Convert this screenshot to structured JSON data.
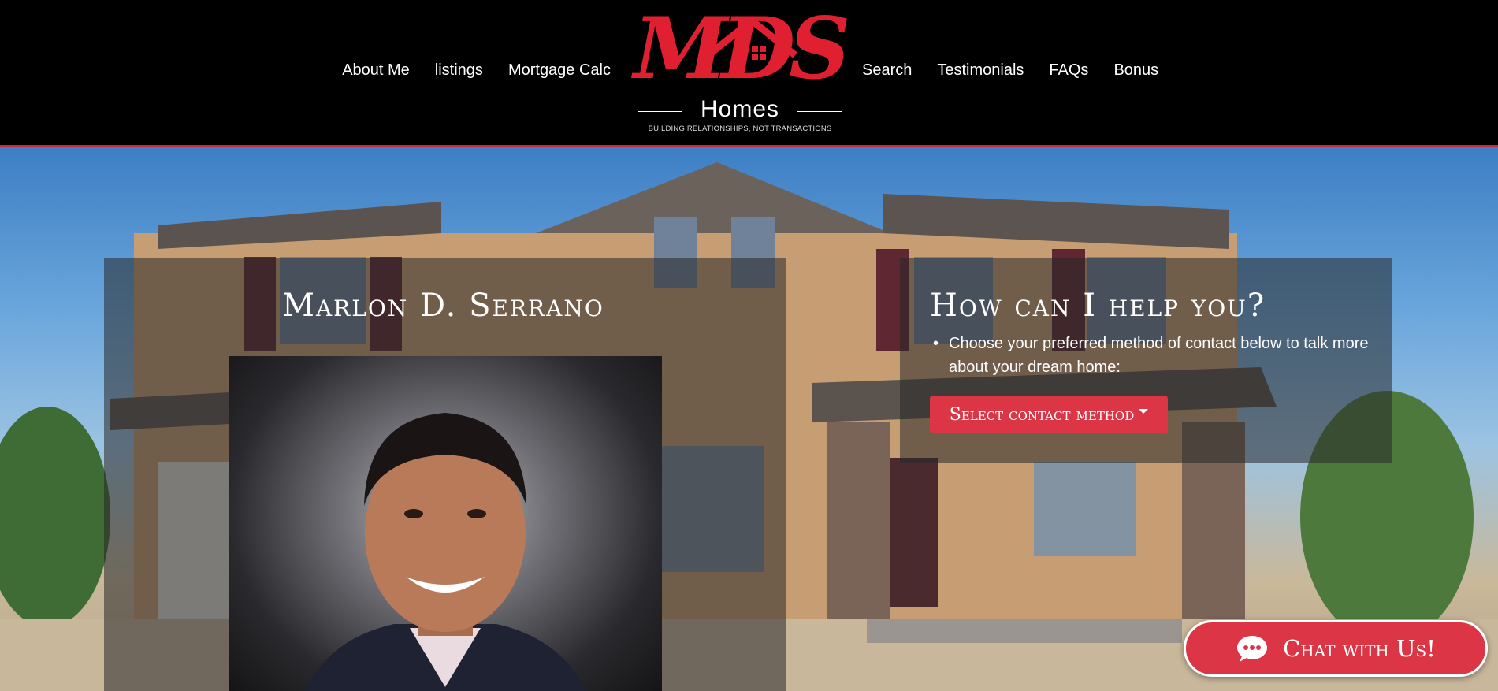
{
  "nav": {
    "left": [
      {
        "label": "About Me"
      },
      {
        "label": "listings"
      },
      {
        "label": "Mortgage Calc"
      }
    ],
    "right": [
      {
        "label": "Search"
      },
      {
        "label": "Testimonials"
      },
      {
        "label": "FAQs"
      },
      {
        "label": "Bonus"
      }
    ]
  },
  "logo": {
    "letters": "MDS",
    "subtitle": "Homes",
    "tagline": "BUILDING RELATIONSHIPS, NOT TRANSACTIONS",
    "brand_color": "#e01f30"
  },
  "agent": {
    "name": "Marlon D. Serrano",
    "photo_icon": "agent-portrait"
  },
  "help": {
    "title": "How can I help you?",
    "bullet": "Choose your preferred method of contact below to talk more about your dream home:",
    "button_label": "Select contact method",
    "button_color": "#dc3545"
  },
  "chat": {
    "label": "Chat with Us!",
    "icon": "chat-bubble-icon"
  }
}
